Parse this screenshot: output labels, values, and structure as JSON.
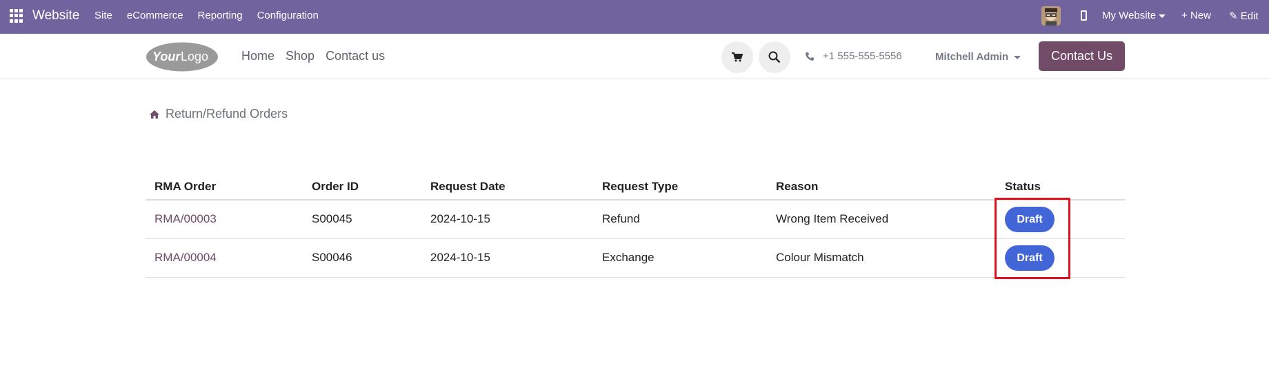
{
  "topbar": {
    "brand": "Website",
    "menu": [
      "Site",
      "eCommerce",
      "Reporting",
      "Configuration"
    ],
    "site_selector": "My Website",
    "new_label": "New",
    "edit_label": "Edit",
    "background": "#71639e"
  },
  "header": {
    "logo_text": "YourLogo",
    "nav": [
      "Home",
      "Shop",
      "Contact us"
    ],
    "phone": "+1 555-555-5556",
    "user": "Mitchell Admin",
    "contact_button": "Contact Us",
    "accent": "#714b67"
  },
  "breadcrumb": {
    "label": "Return/Refund Orders"
  },
  "table": {
    "columns": [
      "RMA Order",
      "Order ID",
      "Request Date",
      "Request Type",
      "Reason",
      "Status"
    ],
    "rows": [
      {
        "rma": "RMA/00003",
        "order_id": "S00045",
        "date": "2024-10-15",
        "type": "Refund",
        "reason": "Wrong Item Received",
        "status": "Draft"
      },
      {
        "rma": "RMA/00004",
        "order_id": "S00046",
        "date": "2024-10-15",
        "type": "Exchange",
        "reason": "Colour Mismatch",
        "status": "Draft"
      }
    ],
    "status_color": "#4266d7"
  },
  "icons": [
    "apps-grid-icon",
    "avatar",
    "mobile-icon",
    "plus-icon",
    "pencil-icon",
    "cart-icon",
    "search-icon",
    "phone-icon",
    "home-icon"
  ]
}
